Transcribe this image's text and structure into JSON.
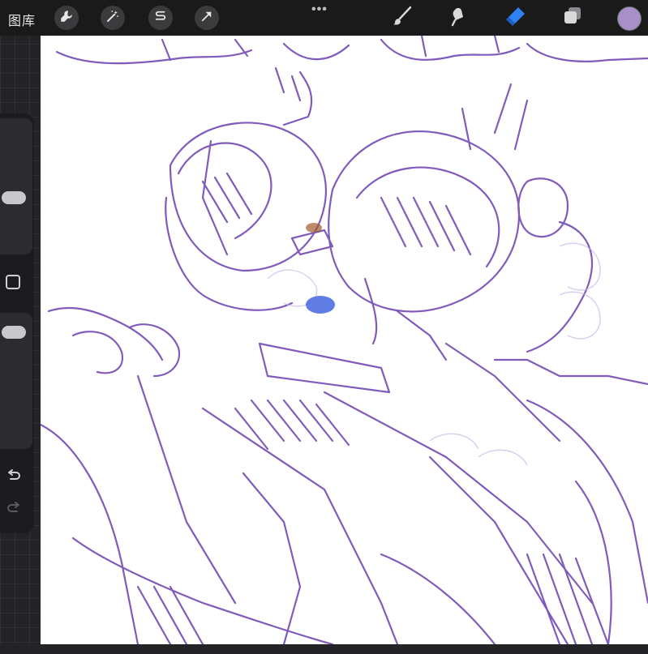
{
  "topbar": {
    "gallery_label": "图库",
    "actions_icon": "wrench-icon",
    "adjustments_icon": "magic-wand-icon",
    "selection_icon": "selection-s-icon",
    "transform_icon": "arrow-cursor-icon",
    "more": "•••",
    "brush_icon": "brush-icon",
    "smudge_icon": "smudge-icon",
    "eraser_icon": "eraser-icon",
    "layers_icon": "layers-icon",
    "current_color": "#a98fc8"
  },
  "sidebar": {
    "brush_size_level": 0.4,
    "opacity_level": 0.08,
    "modify_icon": "square-icon",
    "undo_icon": "undo-icon",
    "redo_icon": "redo-icon"
  },
  "canvas": {
    "stroke_color": "#6a3fb0",
    "accent_eye_color": "#2f55d4",
    "background": "#ffffff"
  }
}
